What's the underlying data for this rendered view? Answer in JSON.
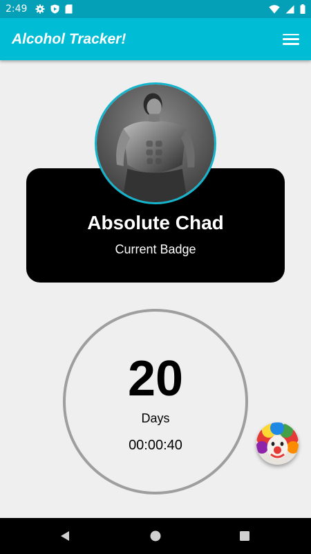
{
  "status_bar": {
    "time": "2:49",
    "left_icons": [
      "gear-icon",
      "play-protect-icon",
      "sd-card-icon"
    ],
    "right_icons": [
      "wifi-icon",
      "signal-icon",
      "battery-icon"
    ]
  },
  "app_bar": {
    "title": "Alcohol Tracker!",
    "menu_icon": "hamburger-menu-icon"
  },
  "badge": {
    "name": "Absolute Chad",
    "subtitle": "Current Badge",
    "avatar_ring_color": "#13b4cc"
  },
  "counter": {
    "days": "20",
    "unit": "Days",
    "elapsed": "00:00:40"
  },
  "fab": {
    "icon": "clown-icon"
  },
  "nav_bar": {
    "buttons": [
      "back-icon",
      "home-icon",
      "recents-icon"
    ]
  },
  "colors": {
    "status_bar": "#03a0b8",
    "app_bar": "#00bcd4",
    "background": "#efefef",
    "badge_card": "#000000",
    "ring": "#9e9e9e"
  }
}
